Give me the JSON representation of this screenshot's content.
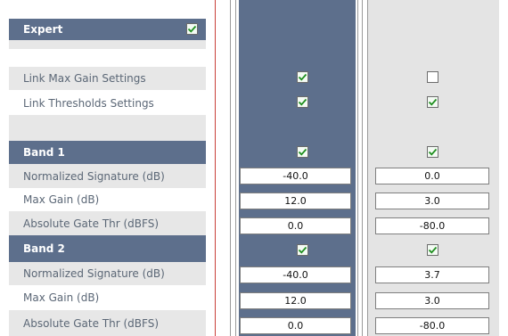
{
  "expert": {
    "label": "Expert",
    "checked": true
  },
  "link_max_gain": {
    "label": "Link Max Gain Settings",
    "col1": true,
    "col2": false
  },
  "link_thresholds": {
    "label": "Link Thresholds Settings",
    "col1": true,
    "col2": true
  },
  "band1": {
    "label": "Band 1",
    "col1": true,
    "col2": true,
    "normalized_signature": {
      "label": "Normalized Signature (dB)",
      "col1": "-40.0",
      "col2": "0.0"
    },
    "max_gain": {
      "label": "Max Gain (dB)",
      "col1": "12.0",
      "col2": "3.0"
    },
    "abs_gate_thr": {
      "label": "Absolute Gate Thr (dBFS)",
      "col1": "0.0",
      "col2": "-80.0"
    }
  },
  "band2": {
    "label": "Band 2",
    "col1": true,
    "col2": true,
    "normalized_signature": {
      "label": "Normalized Signature (dB)",
      "col1": "-40.0",
      "col2": "3.7"
    },
    "max_gain": {
      "label": "Max Gain (dB)",
      "col1": "12.0",
      "col2": "3.0"
    },
    "abs_gate_thr": {
      "label": "Absolute Gate Thr (dBFS)",
      "col1": "0.0",
      "col2": "-80.0"
    }
  }
}
